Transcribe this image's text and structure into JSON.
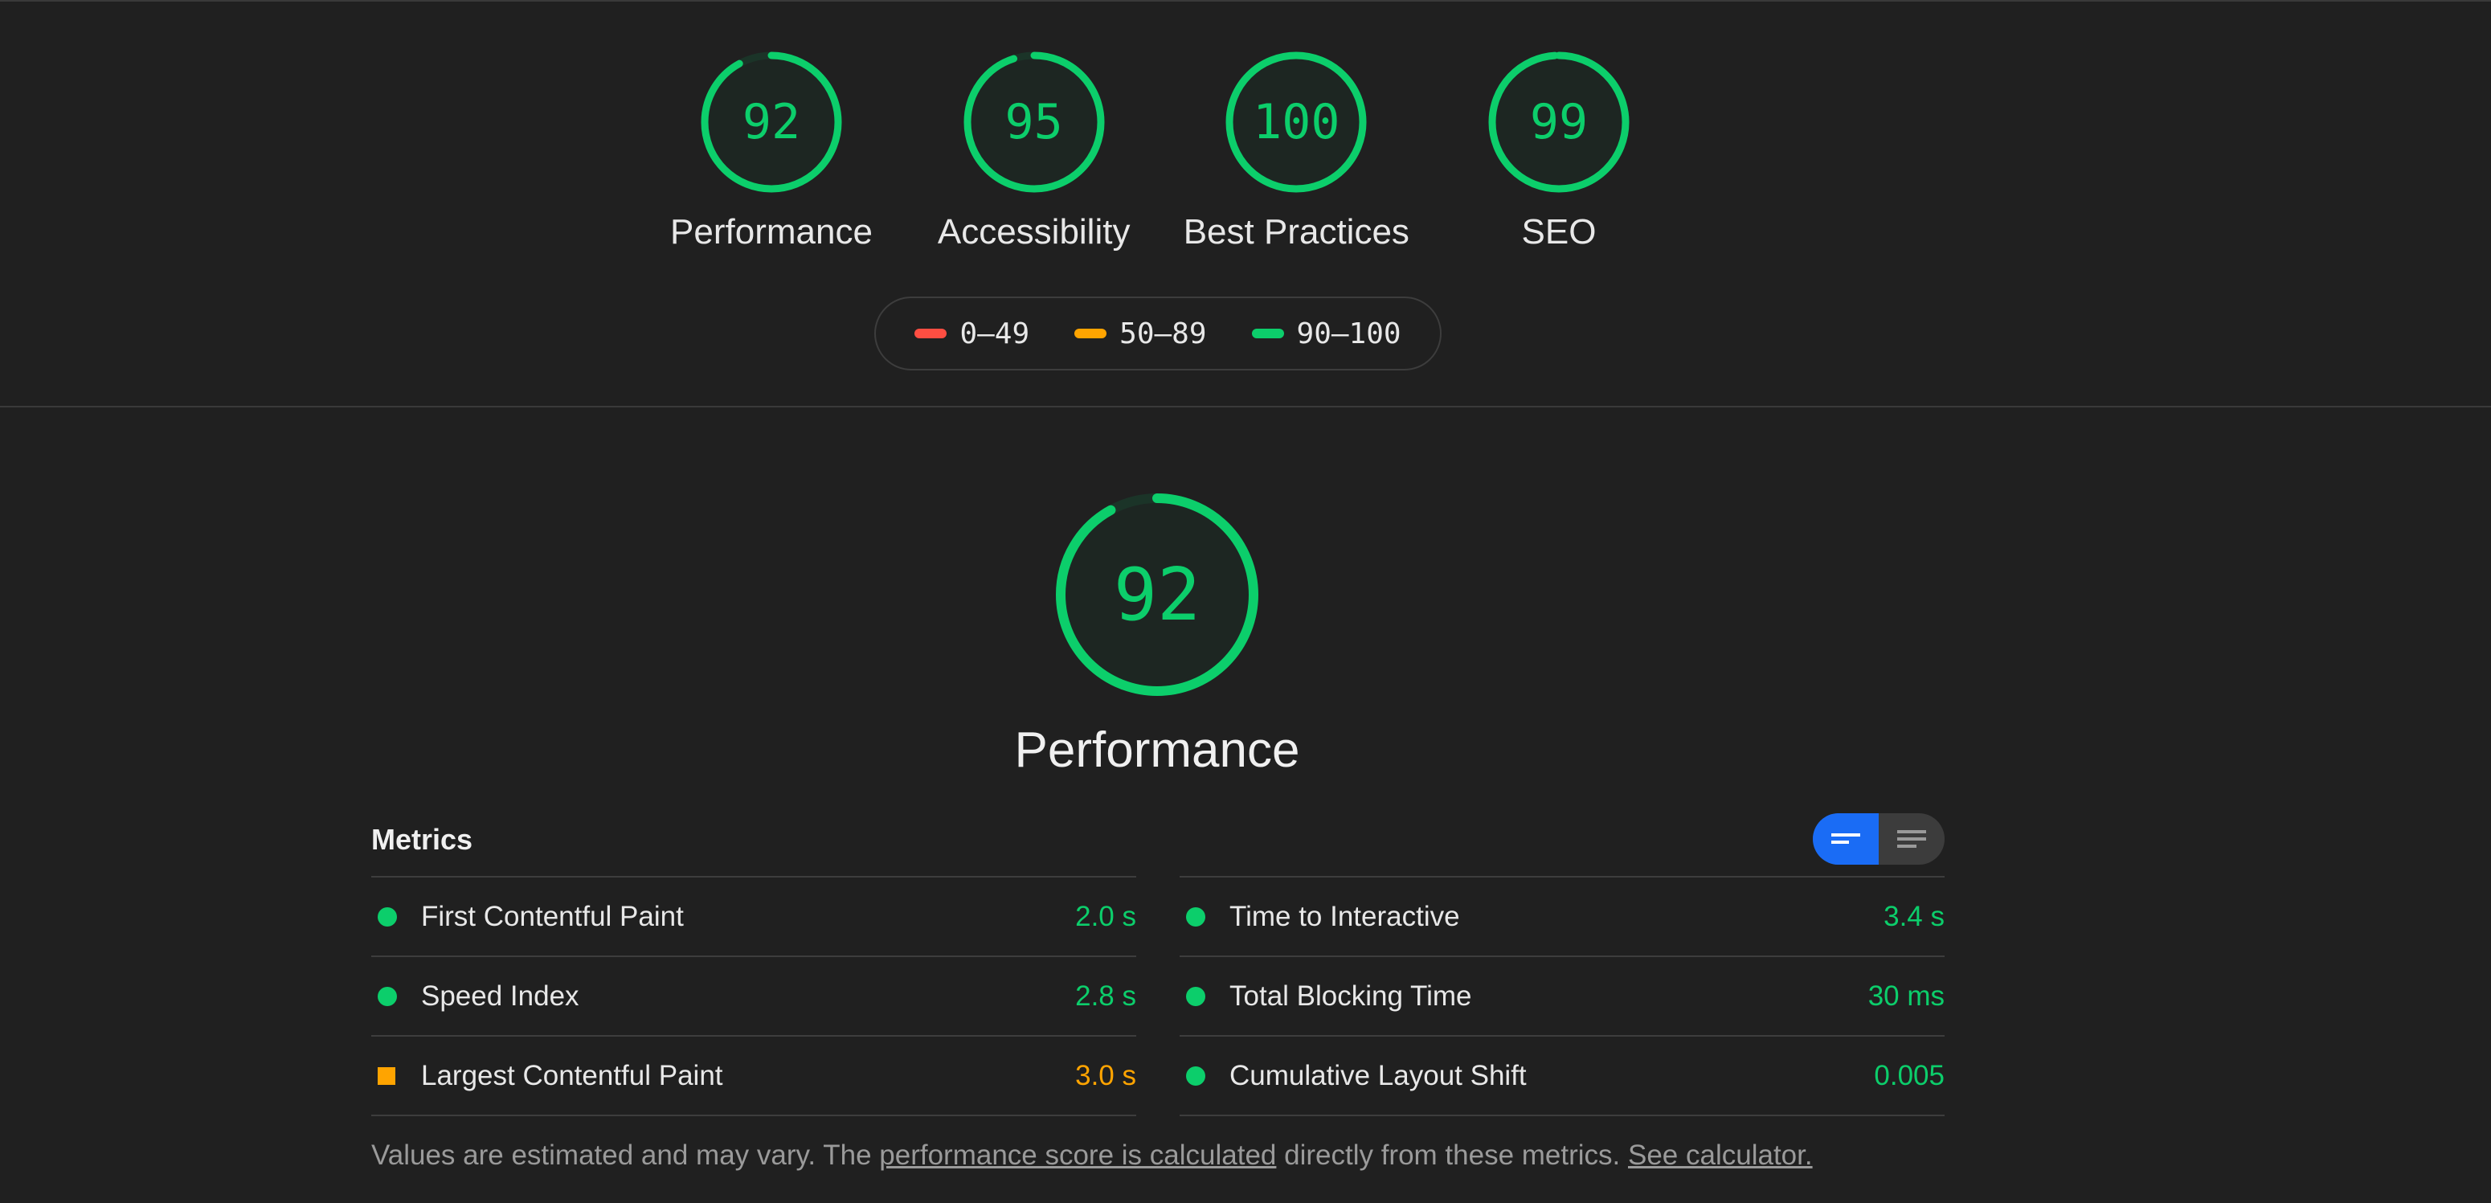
{
  "colors": {
    "pass": "#0cce6b",
    "average": "#ffa400",
    "fail": "#ff4e42",
    "track": "#1b3428",
    "toggle_active": "#1a6cf5"
  },
  "categories": [
    {
      "score": 92,
      "label": "Performance"
    },
    {
      "score": 95,
      "label": "Accessibility"
    },
    {
      "score": 100,
      "label": "Best Practices"
    },
    {
      "score": 99,
      "label": "SEO"
    }
  ],
  "legend": [
    {
      "range": "0–49",
      "rating": "fail"
    },
    {
      "range": "50–89",
      "rating": "average"
    },
    {
      "range": "90–100",
      "rating": "pass"
    }
  ],
  "performance": {
    "score": 92,
    "title": "Performance"
  },
  "metrics": {
    "title": "Metrics",
    "toggle": {
      "active": "view-summary",
      "icons": [
        "short-lines-icon",
        "long-lines-icon"
      ]
    },
    "left": [
      {
        "label": "First Contentful Paint",
        "value": "2.0 s",
        "rating": "pass"
      },
      {
        "label": "Speed Index",
        "value": "2.8 s",
        "rating": "pass"
      },
      {
        "label": "Largest Contentful Paint",
        "value": "3.0 s",
        "rating": "average"
      }
    ],
    "right": [
      {
        "label": "Time to Interactive",
        "value": "3.4 s",
        "rating": "pass"
      },
      {
        "label": "Total Blocking Time",
        "value": "30 ms",
        "rating": "pass"
      },
      {
        "label": "Cumulative Layout Shift",
        "value": "0.005",
        "rating": "pass"
      }
    ]
  },
  "footnote": {
    "text1": "Values are estimated and may vary. The ",
    "link1": "performance score is calculated",
    "text2": " directly from these metrics. ",
    "link2": "See calculator."
  }
}
